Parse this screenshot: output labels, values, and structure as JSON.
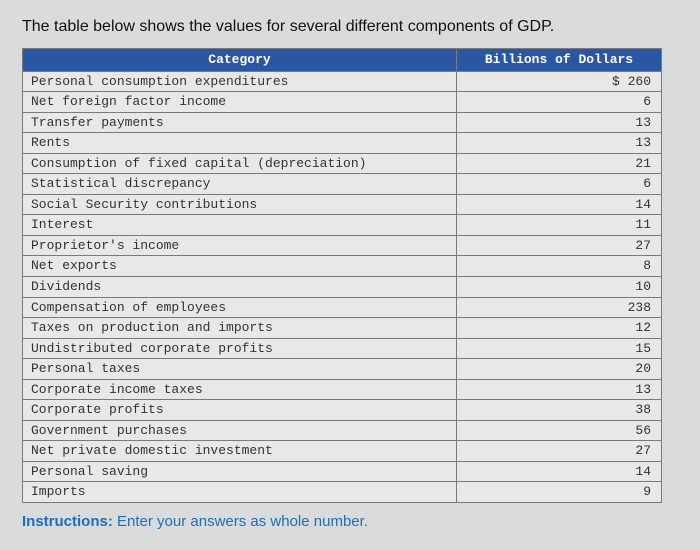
{
  "title": "The table below shows the values for several different components of GDP.",
  "header": {
    "category": "Category",
    "value": "Billions of Dollars"
  },
  "rows": [
    {
      "category": "Personal consumption expenditures",
      "value": "$ 260"
    },
    {
      "category": "Net foreign factor income",
      "value": "6"
    },
    {
      "category": "Transfer payments",
      "value": "13"
    },
    {
      "category": "Rents",
      "value": "13"
    },
    {
      "category": "Consumption of fixed capital (depreciation)",
      "value": "21"
    },
    {
      "category": "Statistical discrepancy",
      "value": "6"
    },
    {
      "category": "Social Security contributions",
      "value": "14"
    },
    {
      "category": "Interest",
      "value": "11"
    },
    {
      "category": "Proprietor's income",
      "value": "27"
    },
    {
      "category": "Net exports",
      "value": "8"
    },
    {
      "category": "Dividends",
      "value": "10"
    },
    {
      "category": "Compensation of employees",
      "value": "238"
    },
    {
      "category": "Taxes on production and imports",
      "value": "12"
    },
    {
      "category": "Undistributed corporate profits",
      "value": "15"
    },
    {
      "category": "Personal taxes",
      "value": "20"
    },
    {
      "category": "Corporate income taxes",
      "value": "13"
    },
    {
      "category": "Corporate profits",
      "value": "38"
    },
    {
      "category": "Government purchases",
      "value": "56"
    },
    {
      "category": "Net private domestic investment",
      "value": "27"
    },
    {
      "category": "Personal saving",
      "value": "14"
    },
    {
      "category": "Imports",
      "value": "9"
    }
  ],
  "instructions": {
    "label": "Instructions:",
    "text": "Enter your answers as whole number."
  }
}
